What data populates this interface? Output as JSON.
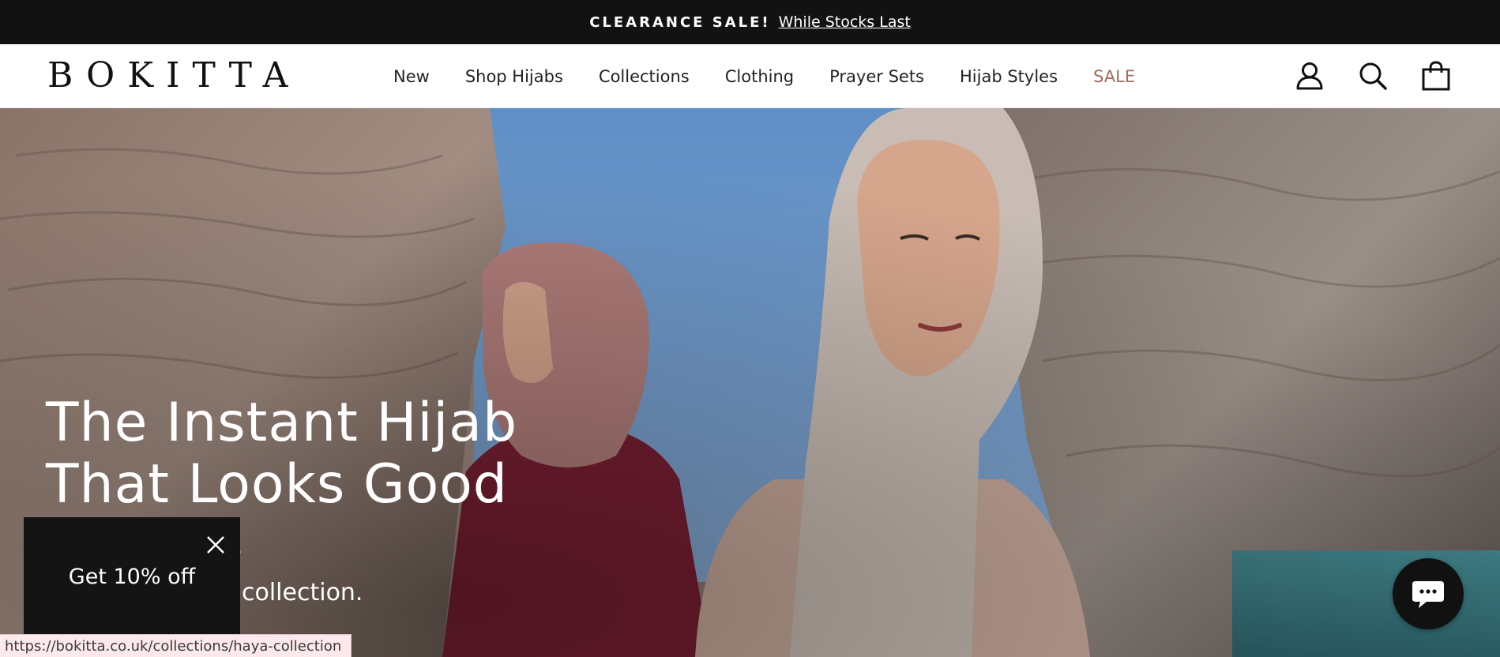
{
  "announcement": {
    "sale_tag": "CLEARANCE SALE!",
    "link_text": "While Stocks Last"
  },
  "header": {
    "logo": "BOKITTA",
    "nav": [
      {
        "label": "New"
      },
      {
        "label": "Shop Hijabs"
      },
      {
        "label": "Collections"
      },
      {
        "label": "Clothing"
      },
      {
        "label": "Prayer Sets"
      },
      {
        "label": "Hijab Styles"
      },
      {
        "label": "SALE"
      }
    ],
    "icons": [
      "account-icon",
      "search-icon",
      "cart-icon"
    ],
    "sale_color": "#a66a5b"
  },
  "hero": {
    "title_line1": "The Instant Hijab",
    "title_line2": "That Looks Good",
    "subtitle_fragment1": ".",
    "subtitle_fragment2": "collection."
  },
  "promo": {
    "label": "Get 10% off"
  },
  "chat": {
    "icon": "chat-bubble-icon"
  },
  "status_bar": {
    "url": "https://bokitta.co.uk/collections/haya-collection"
  },
  "colors": {
    "announcement_bg": "#121212",
    "promo_bg": "#141414",
    "status_bg": "#fde8eb"
  }
}
